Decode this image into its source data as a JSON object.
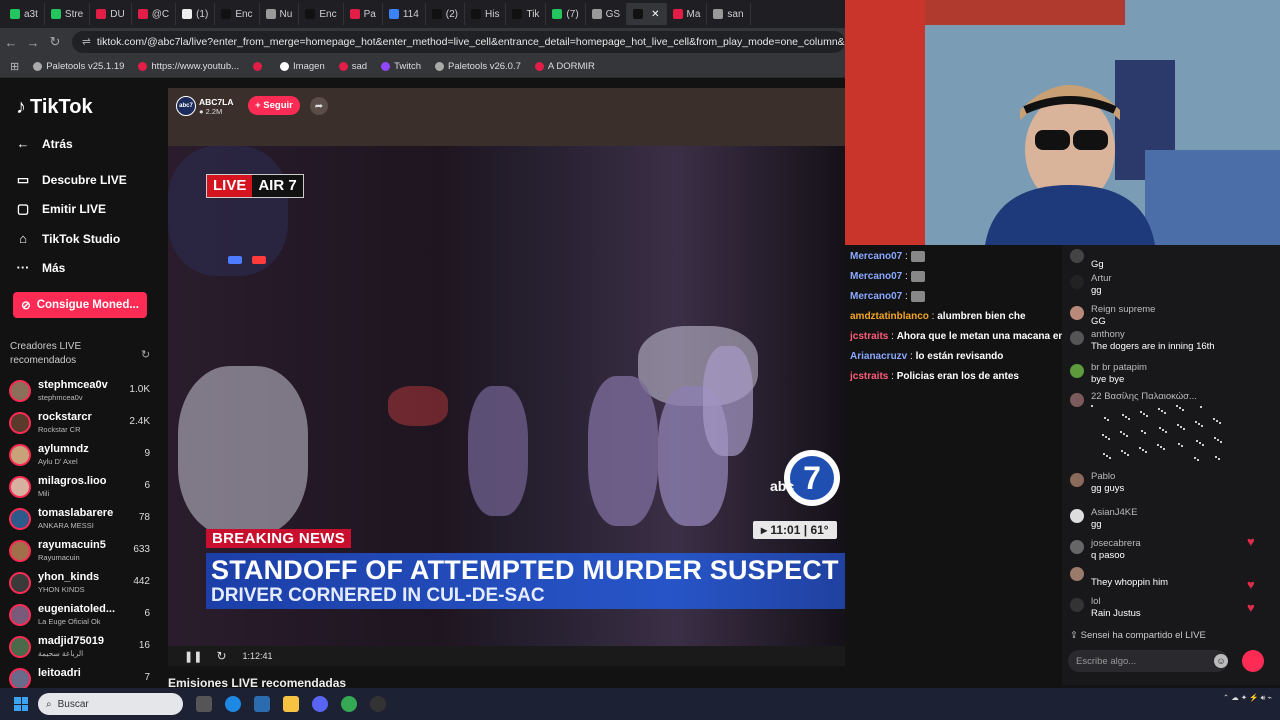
{
  "browser": {
    "tabs": [
      {
        "label": "a3t",
        "color": "#22c55e"
      },
      {
        "label": "Stre",
        "color": "#22c55e"
      },
      {
        "label": "DU",
        "color": "#e11d48"
      },
      {
        "label": "@C",
        "color": "#e11d48"
      },
      {
        "label": "(1)",
        "color": "#eeeeee"
      },
      {
        "label": "Enc",
        "color": "#111111"
      },
      {
        "label": "Nu",
        "color": "#999999"
      },
      {
        "label": "Enc",
        "color": "#111111"
      },
      {
        "label": "Pa",
        "color": "#e11d48"
      },
      {
        "label": "114",
        "color": "#3b82f6"
      },
      {
        "label": "(2)",
        "color": "#111111"
      },
      {
        "label": "His",
        "color": "#111111"
      },
      {
        "label": "Tik",
        "color": "#111111"
      },
      {
        "label": "(7)",
        "color": "#22c55e"
      },
      {
        "label": "GS",
        "color": "#999999"
      },
      {
        "label": "",
        "color": "#111111"
      },
      {
        "label": "Ma",
        "color": "#e11d48"
      },
      {
        "label": "san",
        "color": "#999999"
      }
    ],
    "url": "tiktok.com/@abc7la/live?enter_from_merge=homepage_hot&enter_method=live_cell&entrance_detail=homepage_hot_live_cell&from_play_mode=one_column&is_guest_connect=",
    "bookmarks": [
      {
        "label": "Paletools v25.1.19",
        "color": "#aaaaaa"
      },
      {
        "label": "https://www.youtub...",
        "color": "#e11d48"
      },
      {
        "label": "",
        "color": "#e11d48"
      },
      {
        "label": "Imagen",
        "color": "#ffffff"
      },
      {
        "label": "sad",
        "color": "#e11d48"
      },
      {
        "label": "Twitch",
        "color": "#9146ff"
      },
      {
        "label": "Paletools v26.0.7",
        "color": "#aaaaaa"
      },
      {
        "label": "A DORMIR",
        "color": "#e11d48"
      }
    ]
  },
  "tiktok": {
    "logo": "TikTok",
    "nav": {
      "back": "Atrás",
      "discover": "Descubre LIVE",
      "go_live": "Emitir LIVE",
      "studio": "TikTok Studio",
      "more": "Más"
    },
    "coins_button": "Consigue Moned...",
    "creators_heading": "Creadores LIVE recomendados",
    "creators": [
      {
        "name": "stephmcea0v",
        "sub": "stephmcea0v",
        "count": "1.0K"
      },
      {
        "name": "rockstarcr",
        "sub": "Rockstar CR",
        "count": "2.4K"
      },
      {
        "name": "aylumndz",
        "sub": "Aylu D' Axel",
        "count": "9"
      },
      {
        "name": "milagros.lioo",
        "sub": "Mili",
        "count": "6"
      },
      {
        "name": "tomaslabarere",
        "sub": "ANKARA MESSI",
        "count": "78"
      },
      {
        "name": "rayumacuin5",
        "sub": "Rayumacuin",
        "count": "633"
      },
      {
        "name": "yhon_kinds",
        "sub": "YHON KINDS",
        "count": "442"
      },
      {
        "name": "eugeniatoled...",
        "sub": "La Euge Oficial Ok",
        "count": "6"
      },
      {
        "name": "madjid75019",
        "sub": "الرباعة سحيمة",
        "count": "16"
      },
      {
        "name": "leitoadri",
        "sub": "",
        "count": "7"
      }
    ],
    "recommended_heading": "Emisiones LIVE recomendadas"
  },
  "stream": {
    "channel": "ABC7LA",
    "viewers": "2.2M",
    "follow": "+ Seguir",
    "live_badge": "LIVE",
    "air_badge": "AIR 7",
    "breaking": "BREAKING NEWS",
    "headline": "STANDOFF OF ATTEMPTED MURDER SUSPECT",
    "subheadline": "DRIVER CORNERED IN CUL-DE-SAC",
    "logo_text": "abc",
    "logo_number": "7",
    "time": "11:01",
    "temp": "61°",
    "elapsed": "1:12:41"
  },
  "chat_left": [
    {
      "user": "Mercano07",
      "text": "",
      "user_color": "#8aa8ff"
    },
    {
      "user": "Mercano07",
      "text": "",
      "user_color": "#8aa8ff"
    },
    {
      "user": "Mercano07",
      "text": "",
      "user_color": "#8aa8ff"
    },
    {
      "user": "amdztatinblanco",
      "text": "alumbren bien che",
      "user_color": "#f5a623"
    },
    {
      "user": "jcstraits",
      "text": "Ahora que le metan una macana en el orto",
      "user_color": "#ff5c7c"
    },
    {
      "user": "Arianacruzv",
      "text": "lo están revisando",
      "user_color": "#8aa8ff"
    },
    {
      "user": "jcstraits",
      "text": "Policias eran los de antes",
      "user_color": "#ff5c7c"
    }
  ],
  "chat_right": [
    {
      "user": "",
      "text": "Gg"
    },
    {
      "user": "Artur",
      "text": "gg"
    },
    {
      "user": "Reign supreme",
      "text": "GG"
    },
    {
      "user": "anthony",
      "text": "The dogers are in inning 16th"
    },
    {
      "user": "br br patapim",
      "text": "bye bye"
    },
    {
      "user": "22 Βασίλης Παλαιοκώσ...",
      "text": ""
    },
    {
      "user": "Pablo",
      "text": "gg guys"
    },
    {
      "user": "AsianJ4KE",
      "text": "gg"
    },
    {
      "user": "josecabrera",
      "text": "q pasoo"
    },
    {
      "user": "",
      "text": "They whoppin him"
    },
    {
      "user": "lol",
      "text": "Rain Justus"
    }
  ],
  "shared": {
    "user": "Sensei",
    "text": "ha compartido el LIVE"
  },
  "chat_placeholder": "Escribe algo...",
  "taskbar": {
    "search": "Buscar"
  }
}
